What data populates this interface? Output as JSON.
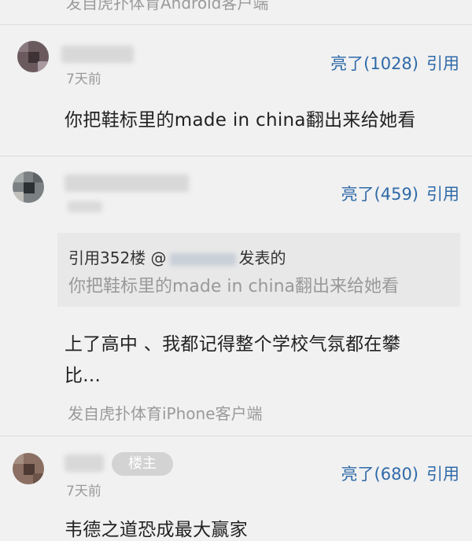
{
  "top_source": "发自虎扑体育Android客户端",
  "comments": [
    {
      "time": "7天前",
      "like_label": "亮了(1028)",
      "quote_label": "引用",
      "content": "你把鞋标里的made in china翻出来给她看"
    },
    {
      "time": "7天前",
      "like_label": "亮了(459)",
      "quote_label": "引用",
      "quote_prefix": "引用352楼 @",
      "quote_suffix": "发表的",
      "quote_text": "你把鞋标里的made in china翻出来给她看",
      "content_line1": "上了高中 、我都记得整个学校气氛都在攀",
      "content_line2": "比...",
      "source": "发自虎扑体育iPhone客户端"
    },
    {
      "badge": "楼主",
      "time": "7天前",
      "like_label": "亮了(680)",
      "quote_label": "引用",
      "content": "韦德之道恐成最大赢家"
    }
  ]
}
